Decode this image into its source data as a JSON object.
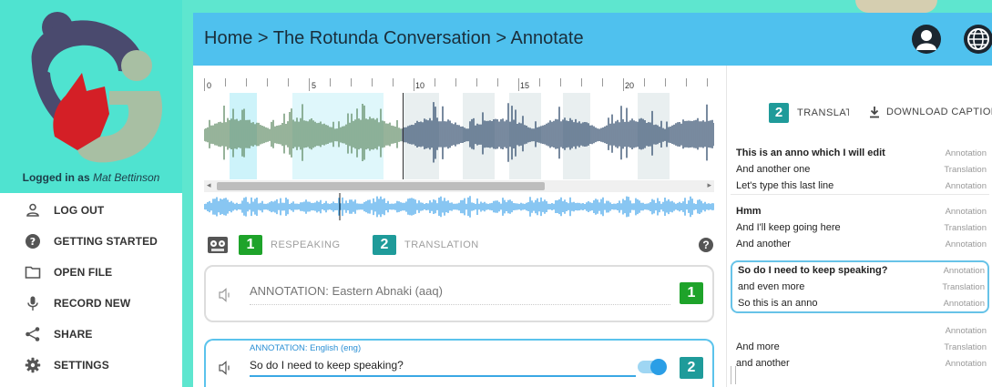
{
  "sidebar": {
    "logged_in_prefix": "Logged in as ",
    "user_name": "Mat Bettinson",
    "items": [
      {
        "label": "LOG OUT",
        "icon": "person-icon"
      },
      {
        "label": "GETTING STARTED",
        "icon": "help-icon"
      },
      {
        "label": "OPEN FILE",
        "icon": "folder-icon"
      },
      {
        "label": "RECORD NEW",
        "icon": "microphone-icon"
      },
      {
        "label": "SHARE",
        "icon": "share-icon"
      },
      {
        "label": "SETTINGS",
        "icon": "gear-icon"
      }
    ]
  },
  "header": {
    "title": "Home > The Rotunda Conversation > Annotate",
    "icons": [
      "account-icon",
      "globe-icon"
    ]
  },
  "ruler": {
    "labels": [
      "0",
      "5",
      "10",
      "15",
      "20"
    ]
  },
  "tabs": [
    {
      "badge": "1",
      "label": "RESPEAKING",
      "color": "#1ea32a"
    },
    {
      "badge": "2",
      "label": "TRANSLATION",
      "color": "#1f9b9a"
    }
  ],
  "help": "?",
  "annotation1": {
    "placeholder": "ANNOTATION: Eastern Abnaki (aaq)",
    "badge": "1",
    "badge_color": "#1ea32a"
  },
  "annotation2": {
    "label": "ANNOTATION: English (eng)",
    "value": "So do I need to keep speaking?",
    "badge": "2",
    "badge_color": "#1f9b9a",
    "toggle_on": true
  },
  "right_panel": {
    "translate_badge": "2",
    "translate_label": "TRANSLATE",
    "download_label": "DOWNLOAD CAPTIONS",
    "segments": [
      {
        "rows": [
          {
            "text": "This is an anno which I will edit",
            "type": "Annotation",
            "bold": true
          },
          {
            "text": "And another one",
            "type": "Translation"
          },
          {
            "text": "Let's type this last line",
            "type": "Annotation"
          }
        ]
      },
      {
        "rows": [
          {
            "text": "Hmm",
            "type": "Annotation",
            "bold": true
          },
          {
            "text": "And I'll keep going here",
            "type": "Translation"
          },
          {
            "text": "And another",
            "type": "Annotation"
          }
        ]
      },
      {
        "rows": [
          {
            "text": "So do I need to keep speaking?",
            "type": "Annotation",
            "bold": true
          },
          {
            "text": "and even more",
            "type": "Translation"
          },
          {
            "text": "So this is an anno",
            "type": "Annotation"
          }
        ]
      },
      {
        "rows": [
          {
            "text": "",
            "type": "Annotation"
          },
          {
            "text": "And more",
            "type": "Translation"
          },
          {
            "text": "and another",
            "type": "Annotation"
          }
        ]
      }
    ]
  },
  "colors": {
    "teal_bg": "#5ee6cf",
    "header": "#4fc1ee",
    "respeak_green": "#1ea32a",
    "translation_teal": "#1f9b9a",
    "wave_green": "#5f8a63",
    "wave_dark": "#2f4a6b",
    "mini_wave": "#3aa0e8",
    "selection_blue": "#5bc3ec"
  }
}
